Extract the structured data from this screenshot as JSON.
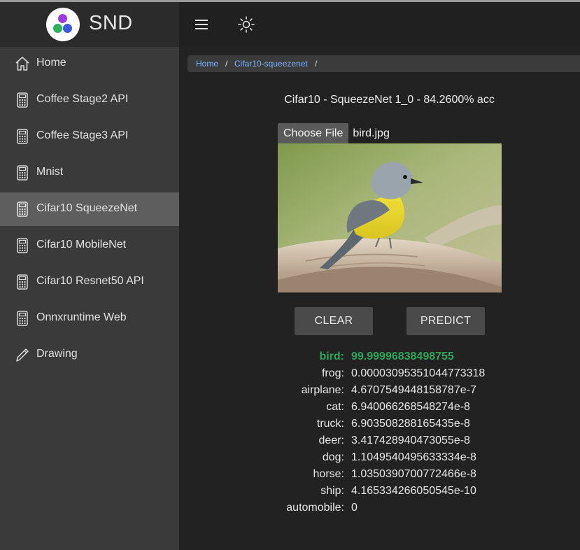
{
  "app": {
    "name": "SND",
    "colors": {
      "accent_green": "#2ea55a",
      "link_blue": "#7fb2ff",
      "sidebar_active": "#5e5e5e"
    }
  },
  "header": {
    "menu_icon": "hamburger-menu-icon",
    "theme_icon": "sun-icon"
  },
  "sidebar": {
    "items": [
      {
        "label": "Home",
        "icon": "home-icon",
        "active": false
      },
      {
        "label": "Coffee Stage2 API",
        "icon": "calculator-icon",
        "active": false
      },
      {
        "label": "Coffee Stage3 API",
        "icon": "calculator-icon",
        "active": false
      },
      {
        "label": "Mnist",
        "icon": "calculator-icon",
        "active": false
      },
      {
        "label": "Cifar10 SqueezeNet",
        "icon": "calculator-icon",
        "active": true
      },
      {
        "label": "Cifar10 MobileNet",
        "icon": "calculator-icon",
        "active": false
      },
      {
        "label": "Cifar10 Resnet50 API",
        "icon": "calculator-icon",
        "active": false
      },
      {
        "label": "Onnxruntime Web",
        "icon": "calculator-icon",
        "active": false
      },
      {
        "label": "Drawing",
        "icon": "pencil-icon",
        "active": false
      }
    ]
  },
  "breadcrumb": {
    "items": [
      "Home",
      "Cifar10-squeezenet"
    ],
    "separator": "/"
  },
  "main": {
    "title": "Cifar10 - SqueezeNet 1_0 - 84.2600% acc",
    "file": {
      "button_label": "Choose File",
      "file_name": "bird.jpg"
    },
    "clear_label": "CLEAR",
    "predict_label": "PREDICT",
    "results": [
      {
        "label": "bird:",
        "value": "99.99996838498755"
      },
      {
        "label": "frog:",
        "value": "0.00003095351044773318"
      },
      {
        "label": "airplane:",
        "value": "4.6707549448158787e-7"
      },
      {
        "label": "cat:",
        "value": "6.940066268548274e-8"
      },
      {
        "label": "truck:",
        "value": "6.903508288165435e-8"
      },
      {
        "label": "deer:",
        "value": "3.417428940473055e-8"
      },
      {
        "label": "dog:",
        "value": "1.1049540495633334e-8"
      },
      {
        "label": "horse:",
        "value": "1.0350390700772466e-8"
      },
      {
        "label": "ship:",
        "value": "4.165334266050545e-10"
      },
      {
        "label": "automobile:",
        "value": "0"
      }
    ]
  }
}
